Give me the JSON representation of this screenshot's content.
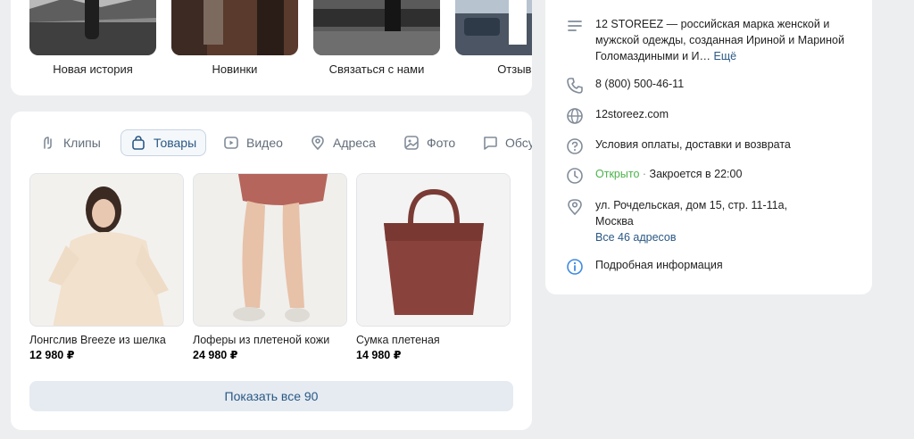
{
  "stories": [
    {
      "label": "Новая история"
    },
    {
      "label": "Новинки"
    },
    {
      "label": "Связаться с нами"
    },
    {
      "label": "Отзывы"
    }
  ],
  "tabs": [
    {
      "label": "Клипы",
      "icon": "clips-icon"
    },
    {
      "label": "Товары",
      "icon": "bag-icon",
      "active": true
    },
    {
      "label": "Видео",
      "icon": "video-icon"
    },
    {
      "label": "Адреса",
      "icon": "location-icon"
    },
    {
      "label": "Фото",
      "icon": "photo-icon"
    },
    {
      "label": "Обсуждения",
      "icon": "chat-icon"
    }
  ],
  "products": [
    {
      "name": "Лонгслив Breeze из шелка",
      "price": "12 980 ₽"
    },
    {
      "name": "Лоферы из плетеной кожи",
      "price": "24 980 ₽"
    },
    {
      "name": "Сумка плетеная",
      "price": "14 980 ₽"
    }
  ],
  "show_all_label": "Показать все 90",
  "info": {
    "description": "12 STOREEZ — российская марка женской и мужской одежды, созданная Ириной и Мариной Голомаздиными и И…",
    "more_label": "Ещё",
    "phone": "8 (800) 500-46-11",
    "website": "12storeez.com",
    "terms": "Условия оплаты, доставки и возврата",
    "status_open": "Открыто",
    "status_separator": "·",
    "status_close": "Закроется в 22:00",
    "address": "ул. Рочдельская, дом 15, стр. 11-11а, Москва",
    "all_addresses": "Все 46 адресов",
    "details": "Подробная информация"
  },
  "colors": {
    "link": "#2a5885",
    "open": "#4bb34b",
    "background": "#edeef0"
  }
}
